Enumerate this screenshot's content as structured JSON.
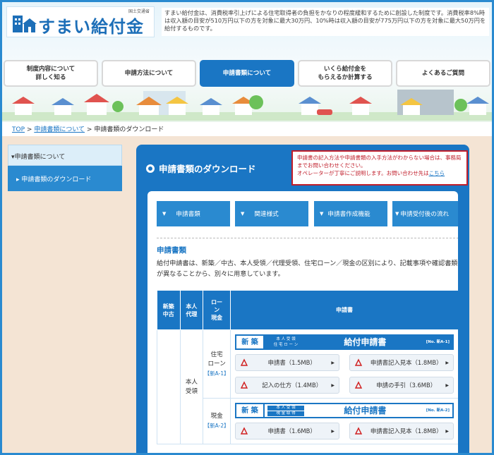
{
  "header": {
    "ministry": "国土交通省",
    "logo_title": "すまい給付金",
    "description": "すまい給付金は、消費税率引上げによる住宅取得者の負担をかなりの程度緩和するために創設した制度です。消費税率8%時は収入額の目安が510万円以下の方を対象に最大30万円、10%時は収入額の目安が775万円以下の方を対象に最大50万円を給付するものです。"
  },
  "nav": [
    {
      "label": "制度内容について\n詳しく知る"
    },
    {
      "label": "申請方法について"
    },
    {
      "label": "申請書類について"
    },
    {
      "label": "いくら給付金を\nもらえるか計算する"
    },
    {
      "label": "よくあるご質問"
    }
  ],
  "breadcrumb": {
    "top": "TOP",
    "parent": "申請書類について",
    "current": "申請書類のダウンロード",
    "sep": ">"
  },
  "sidebar": {
    "head": "申請書類について",
    "item": "申請書類のダウンロード"
  },
  "main": {
    "title": "申請書類のダウンロード",
    "notice_line1": "申請書の記入方法や申請書類の入手方法がわからない場合は、事務局までお問い合わせください。",
    "notice_line2": "オペレーターが丁寧にご説明します。お問い合わせ先は",
    "notice_link": "こちら",
    "tabs": [
      "申請書類",
      "関連様式",
      "申請書作成機能",
      "申請受付後の流れ"
    ],
    "section_title": "申請書類",
    "section_desc": "給付申請書は、新築／中古、本人受領／代理受領、住宅ローン／現金の区別により、記載事項や確認書類が異なることから、別々に用意しています。"
  },
  "table": {
    "headers": [
      "新築\n中古",
      "本人\n代理",
      "ロー\nン\n現金",
      "申請書"
    ],
    "receive": "本人\n受領",
    "rows": [
      {
        "type": "住宅\nローン",
        "code": "【新A-1】",
        "banner_new": "新 築",
        "banner_tag1": "本 人 受 領",
        "banner_tag2": "住 宅 ロ ー ン",
        "banner_title": "給付申請書",
        "banner_no": "[No. 新A-1]",
        "downloads": [
          "申請書（1.5MB）",
          "申請書記入見本（1.8MB）",
          "記入の仕方（1.4MB）",
          "申請の手引（3.6MB）"
        ]
      },
      {
        "type": "現金",
        "code": "【新A-2】",
        "banner_new": "新 築",
        "banner_tag1": "本 人 受 領",
        "banner_tag2": "現 金 取 得",
        "banner_title": "給付申請書",
        "banner_no": "[No. 新A-2]",
        "downloads": [
          "申請書（1.6MB）",
          "申請書記入見本（1.8MB）"
        ]
      }
    ]
  },
  "colors": {
    "primary": "#1a76c4",
    "alert": "#c01d2a",
    "background": "#f4e4d4"
  }
}
